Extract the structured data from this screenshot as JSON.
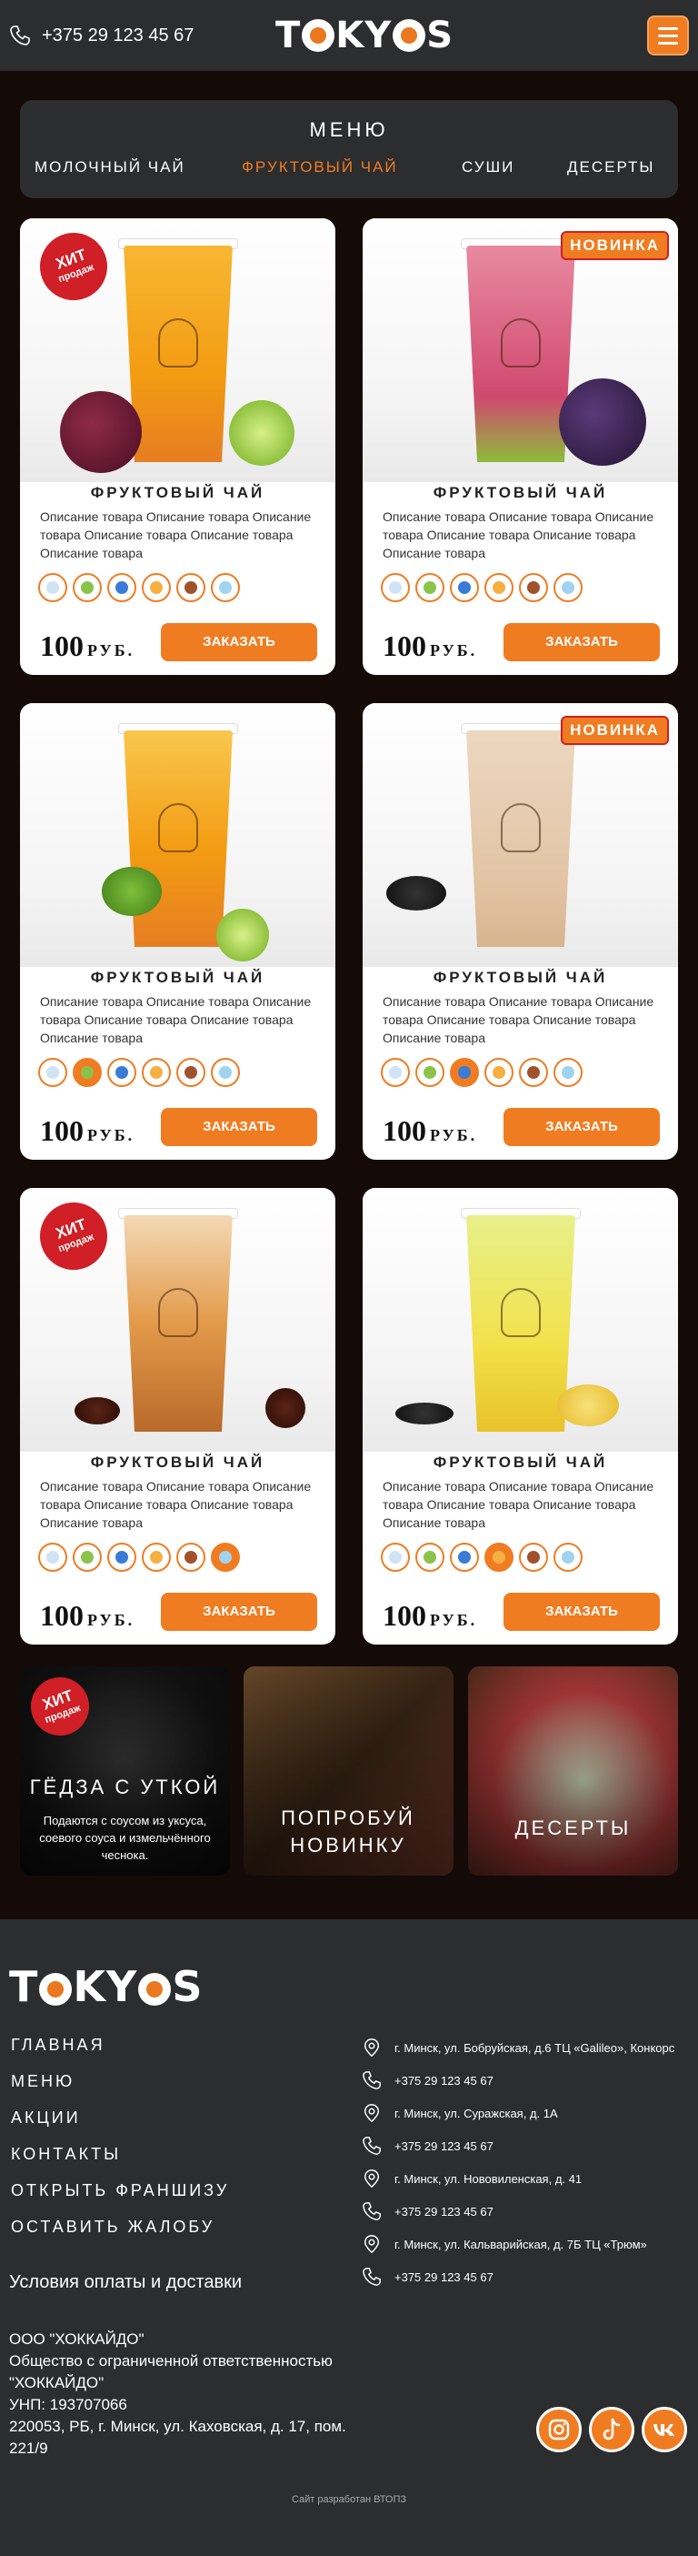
{
  "header": {
    "phone": "+375 29 123 45 67",
    "logo": "TOKYOS",
    "icons": [
      "phone-icon",
      "menu-burger-icon"
    ]
  },
  "menu": {
    "title": "МЕНЮ",
    "tabs": [
      {
        "label": "МОЛОЧНЫЙ ЧАЙ",
        "active": false
      },
      {
        "label": "ФРУКТОВЫЙ ЧАЙ",
        "active": true
      },
      {
        "label": "СУШИ",
        "active": false
      },
      {
        "label": "ДЕСЕРТЫ",
        "active": false
      }
    ]
  },
  "products": [
    {
      "title": "ФРУКТОВЫЙ ЧАЙ",
      "description": "Описание товара Описание товара Описание товара Описание товара Описание товара Описание товара",
      "price": "100",
      "currency": "РУБ.",
      "button": "ЗАКАЗАТЬ",
      "badge": "hit",
      "badge_line1": "ХИТ",
      "badge_line2": "продаж"
    },
    {
      "title": "ФРУКТОВЫЙ ЧАЙ",
      "description": "Описание товара Описание товара Описание товара Описание товара Описание товара Описание товара",
      "price": "100",
      "currency": "РУБ.",
      "button": "ЗАКАЗАТЬ",
      "badge": "new",
      "badge_text": "НОВИНКА"
    },
    {
      "title": "ФРУКТОВЫЙ ЧАЙ",
      "description": "Описание товара Описание товара Описание товара Описание товара Описание товара Описание товара",
      "price": "100",
      "currency": "РУБ.",
      "button": "ЗАКАЗАТЬ",
      "badge": ""
    },
    {
      "title": "ФРУКТОВЫЙ ЧАЙ",
      "description": "Описание товара Описание товара Описание товара Описание товара Описание товара Описание товара",
      "price": "100",
      "currency": "РУБ.",
      "button": "ЗАКАЗАТЬ",
      "badge": "new",
      "badge_text": "НОВИНКА"
    },
    {
      "title": "ФРУКТОВЫЙ ЧАЙ",
      "description": "Описание товара Описание товара Описание товара Описание товара Описание товара Описание товара",
      "price": "100",
      "currency": "РУБ.",
      "button": "ЗАКАЗАТЬ",
      "badge": "hit",
      "badge_line1": "ХИТ",
      "badge_line2": "продаж"
    },
    {
      "title": "ФРУКТОВЫЙ ЧАЙ",
      "description": "Описание товара Описание товара Описание товара Описание товара Описание товара Описание товара",
      "price": "100",
      "currency": "РУБ.",
      "button": "ЗАКАЗАТЬ",
      "badge": ""
    }
  ],
  "ingredient_icons": [
    "milk-icon",
    "kiwi-icon",
    "cup-icon",
    "honeycomb-icon",
    "cinnamon-icon",
    "ice-icon"
  ],
  "promos": [
    {
      "title": "ГЁДЗА С УТКОЙ",
      "text": "Подаются с соусом из уксуса, соевого соуса и измельчённого чеснока.",
      "badge_line1": "ХИТ",
      "badge_line2": "продаж"
    },
    {
      "title": "ПОПРОБУЙ НОВИНКУ"
    },
    {
      "title": "ДЕСЕРТЫ"
    }
  ],
  "footer": {
    "logo": "TOKYOS",
    "links": [
      "ГЛАВНАЯ",
      "МЕНЮ",
      "АКЦИИ",
      "КОНТАКТЫ",
      "ОТКРЫТЬ ФРАНШИЗУ",
      "ОСТАВИТЬ ЖАЛОБУ"
    ],
    "terms": "Условия оплаты и доставки",
    "company": [
      "ООО \"ХОККАЙДО\"",
      "Общество с ограниченной ответственностью \"ХОККАЙДО\"",
      "УНП: 193707066",
      "220053, РБ, г. Минск, ул. Каховская, д. 17, пом. 221/9"
    ],
    "contacts": [
      {
        "type": "location-icon",
        "text": "г. Минск, ул. Бобруйская, д.6 ТЦ «Galileo», Конкорс"
      },
      {
        "type": "phone-icon",
        "text": "+375 29 123 45 67"
      },
      {
        "type": "location-icon",
        "text": "г. Минск, ул. Суражская, д. 1А"
      },
      {
        "type": "phone-icon",
        "text": "+375 29 123 45 67"
      },
      {
        "type": "location-icon",
        "text": "г. Минск, ул. Нововиленская, д. 41"
      },
      {
        "type": "phone-icon",
        "text": "+375 29 123 45 67"
      },
      {
        "type": "location-icon",
        "text": "г. Минск, ул. Кальварийская, д. 7Б ТЦ «Трюм»"
      },
      {
        "type": "phone-icon",
        "text": "+375 29 123 45 67"
      }
    ],
    "social": [
      "instagram-icon",
      "tiktok-icon",
      "vk-icon"
    ],
    "credit": "Сайт разработан ВТОПЗ"
  },
  "colors": {
    "accent": "#f07c22",
    "header_bg": "#2b2d2f",
    "page_bg": "#140a08",
    "badge_red": "#d01f26"
  }
}
